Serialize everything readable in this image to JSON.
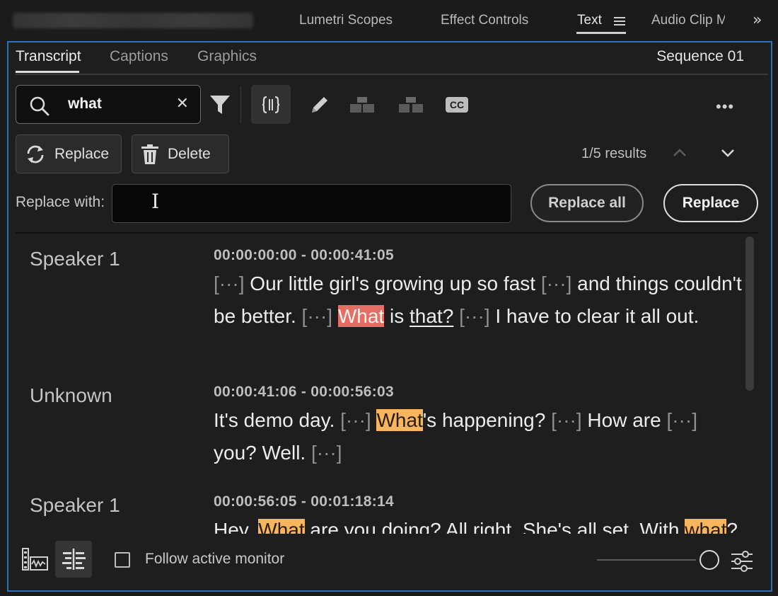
{
  "panel_tabs": [
    {
      "label": "Lumetri Scopes",
      "active": false
    },
    {
      "label": "Effect Controls",
      "active": false
    },
    {
      "label": "Text",
      "active": true
    },
    {
      "label": "Audio Clip M",
      "active": false
    }
  ],
  "sub_tabs": [
    {
      "label": "Transcript",
      "active": true
    },
    {
      "label": "Captions",
      "active": false
    },
    {
      "label": "Graphics",
      "active": false
    }
  ],
  "sequence_name": "Sequence 01",
  "search": {
    "value": "what"
  },
  "toolbar_icons": [
    "filter-icon",
    "case-toggle-icon",
    "pencil-icon",
    "merge-segments-icon",
    "split-segment-icon",
    "closed-captions-icon",
    "more-options-icon"
  ],
  "actions": {
    "replace_label": "Replace",
    "delete_label": "Delete"
  },
  "results_text": "1/5 results",
  "replace": {
    "label": "Replace with:",
    "value": "",
    "replace_all_label": "Replace all",
    "replace_label": "Replace"
  },
  "transcript": [
    {
      "speaker": "Speaker 1",
      "timecode": "00:00:00:00 - 00:00:41:05",
      "parts": [
        {
          "t": "[···]",
          "k": "pause"
        },
        {
          "t": " Our little girl's growing up so fast ",
          "k": ""
        },
        {
          "t": "[···]",
          "k": "pause"
        },
        {
          "t": " and things couldn't be better. ",
          "k": ""
        },
        {
          "t": "[···]",
          "k": "pause"
        },
        {
          "t": " ",
          "k": ""
        },
        {
          "t": "What",
          "k": "hl-cur"
        },
        {
          "t": " is ",
          "k": ""
        },
        {
          "t": "that?",
          "k": "ul"
        },
        {
          "t": " ",
          "k": ""
        },
        {
          "t": "[···]",
          "k": "pause"
        },
        {
          "t": " I have to clear it all out.",
          "k": ""
        }
      ]
    },
    {
      "speaker": "Unknown",
      "timecode": "00:00:41:06 - 00:00:56:03",
      "parts": [
        {
          "t": "It's demo day. ",
          "k": ""
        },
        {
          "t": "[···]",
          "k": "pause"
        },
        {
          "t": " ",
          "k": ""
        },
        {
          "t": "What",
          "k": "hl"
        },
        {
          "t": "'s happening? ",
          "k": ""
        },
        {
          "t": "[···]",
          "k": "pause"
        },
        {
          "t": " How are ",
          "k": ""
        },
        {
          "t": "[···]",
          "k": "pause"
        },
        {
          "t": " you? Well. ",
          "k": ""
        },
        {
          "t": "[···]",
          "k": "pause"
        }
      ]
    },
    {
      "speaker": "Speaker 1",
      "timecode": "00:00:56:05 - 00:01:18:14",
      "parts": [
        {
          "t": "Hey. ",
          "k": ""
        },
        {
          "t": "What",
          "k": "hl"
        },
        {
          "t": " are you doing? All right. She's all set. With ",
          "k": ""
        },
        {
          "t": "what",
          "k": "hl"
        },
        {
          "t": "?",
          "k": ""
        }
      ]
    }
  ],
  "footer": {
    "follow_label": "Follow active monitor",
    "follow_checked": false,
    "zoom_level": 0.95
  },
  "colors": {
    "focus_border": "#2f6fb7",
    "current_match": "#e66d63",
    "match": "#f7b55e"
  }
}
